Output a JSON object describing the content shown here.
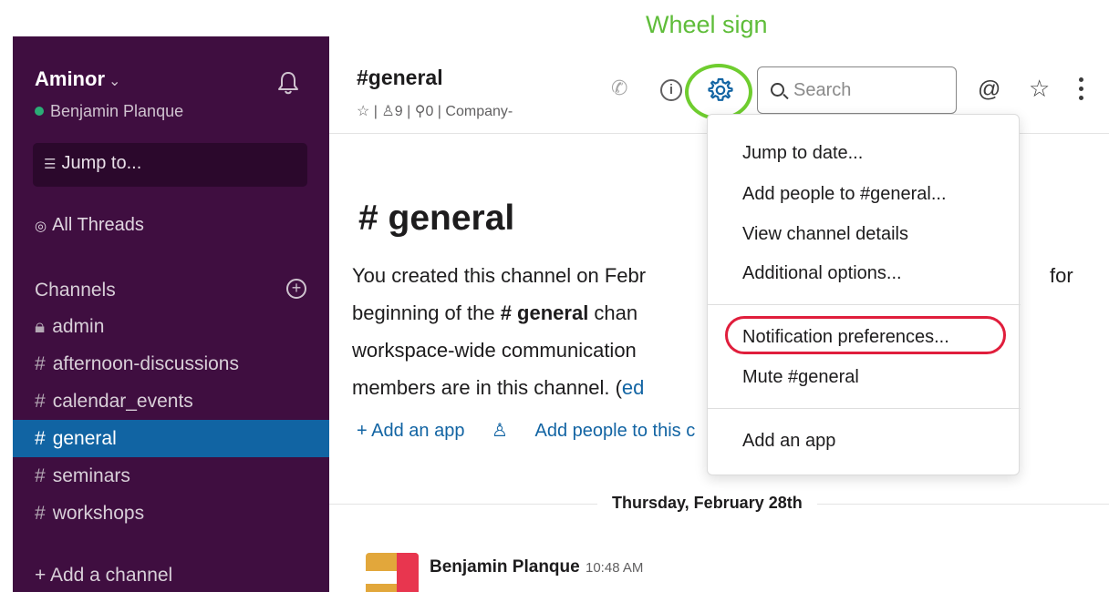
{
  "annotation": {
    "label": "Wheel sign",
    "gear_highlight_color": "#6fcd2f",
    "menu_highlight_color": "#e01e3c"
  },
  "sidebar": {
    "workspace": "Aminor",
    "user": "Benjamin Planque",
    "jump": "Jump to...",
    "threads": "All Threads",
    "channels_header": "Channels",
    "channels": [
      {
        "prefix": "🔒",
        "name": "admin"
      },
      {
        "prefix": "#",
        "name": "afternoon-discussions"
      },
      {
        "prefix": "#",
        "name": "calendar_events"
      },
      {
        "prefix": "#",
        "name": "general",
        "active": true
      },
      {
        "prefix": "#",
        "name": "seminars"
      },
      {
        "prefix": "#",
        "name": "workshops"
      }
    ],
    "add_channel": "+ Add a channel",
    "colors": {
      "bg": "#3f0e40",
      "active": "#1164a3"
    }
  },
  "header": {
    "channel": "#general",
    "meta": "☆ | ꠸ 9 | ⚲ 0 | Company-",
    "meta_star": "☆",
    "members": "9",
    "pins": "0",
    "topic": "Company-",
    "search_placeholder": "Search",
    "icons": [
      "phone-icon",
      "info-icon",
      "gear-icon",
      "search-icon",
      "at-icon",
      "star-icon",
      "kebab-icon"
    ]
  },
  "main": {
    "title": "# general",
    "intro_line1": "You created this channel on Febr",
    "intro_line2_a": "beginning of the ",
    "intro_line2_b": "# general",
    "intro_line2_c": " chan",
    "intro_for": "for",
    "intro_line3": "workspace-wide communication",
    "intro_line4_a": "members are in this channel. (",
    "intro_line4_b": "ed",
    "add_app": "+ Add an app",
    "add_people": "Add people to this c",
    "date_divider": "Thursday, February 28th",
    "message": {
      "author": "Benjamin Planque",
      "time": "10:48 AM"
    }
  },
  "menu": {
    "items_group1": [
      "Jump to date...",
      "Add people to #general...",
      "View channel details",
      "Additional options..."
    ],
    "items_group2": [
      "Notification preferences...",
      "Mute #general"
    ],
    "items_group3": [
      "Add an app"
    ]
  }
}
